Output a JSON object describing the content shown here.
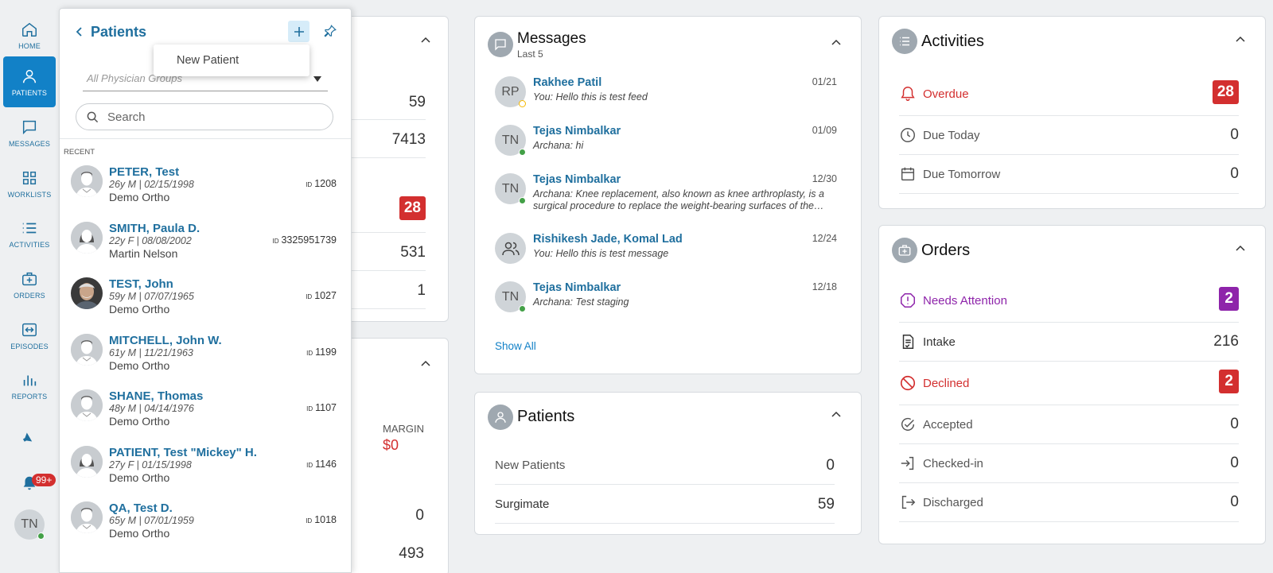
{
  "nav": {
    "items": [
      {
        "label": "HOME",
        "icon": "home-icon"
      },
      {
        "label": "PATIENTS",
        "icon": "person-icon"
      },
      {
        "label": "MESSAGES",
        "icon": "chat-icon"
      },
      {
        "label": "WORKLISTS",
        "icon": "grid-icon"
      },
      {
        "label": "ACTIVITIES",
        "icon": "list-icon"
      },
      {
        "label": "ORDERS",
        "icon": "medical-bag-icon"
      },
      {
        "label": "EPISODES",
        "icon": "episodes-icon"
      },
      {
        "label": "REPORTS",
        "icon": "bar-chart-icon"
      }
    ],
    "notification_badge": "99+",
    "user_initials": "TN"
  },
  "patients_panel": {
    "title": "Patients",
    "new_patient_menu": "New Patient",
    "group_placeholder": "All Physician Groups",
    "search_placeholder": "Search",
    "recent_label": "RECENT",
    "id_prefix": "ID",
    "patients": [
      {
        "name": "PETER, Test",
        "info": "26y M | 02/15/1998",
        "physician": "Demo Ortho",
        "id": "1208",
        "avatar": "male"
      },
      {
        "name": "SMITH, Paula D.",
        "info": "22y F | 08/08/2002",
        "physician": "Martin Nelson",
        "id": "3325951739",
        "avatar": "female"
      },
      {
        "name": "TEST, John",
        "info": "59y M | 07/07/1965",
        "physician": "Demo Ortho",
        "id": "1027",
        "avatar": "photo"
      },
      {
        "name": "MITCHELL, John W.",
        "info": "61y M | 11/21/1963",
        "physician": "Demo Ortho",
        "id": "1199",
        "avatar": "male"
      },
      {
        "name": "SHANE, Thomas",
        "info": "48y M | 04/14/1976",
        "physician": "Demo Ortho",
        "id": "1107",
        "avatar": "male"
      },
      {
        "name": "PATIENT, Test \"Mickey\" H.",
        "info": "27y F | 01/15/1998",
        "physician": "Demo Ortho",
        "id": "1146",
        "avatar": "female"
      },
      {
        "name": "QA, Test D.",
        "info": "65y M | 07/01/1959",
        "physician": "Demo Ortho",
        "id": "1018",
        "avatar": "male"
      }
    ]
  },
  "hidden_card": {
    "values": [
      "59",
      "7413",
      "28",
      "531",
      "1"
    ],
    "margin_label": "MARGIN",
    "margin_value": "$0",
    "values2": [
      "0",
      "493"
    ]
  },
  "messages": {
    "title": "Messages",
    "subtitle": "Last 5",
    "show_all": "Show All",
    "items": [
      {
        "initials": "RP",
        "name": "Rakhee Patil",
        "date": "01/21",
        "text": "You: Hello this is test feed",
        "status": "away"
      },
      {
        "initials": "TN",
        "name": "Tejas Nimbalkar",
        "date": "01/09",
        "text": "Archana: hi",
        "status": "online"
      },
      {
        "initials": "TN",
        "name": "Tejas Nimbalkar",
        "date": "12/30",
        "text": "Archana: Knee replacement, also known as knee arthroplasty, is a surgical procedure to replace the weight-bearing surfaces of the…",
        "status": "online"
      },
      {
        "initials": "",
        "name": "Rishikesh Jade, Komal Lad",
        "date": "12/24",
        "text": "You: Hello this is test message",
        "status": "group"
      },
      {
        "initials": "TN",
        "name": "Tejas Nimbalkar",
        "date": "12/18",
        "text": "Archana: Test staging",
        "status": "online"
      }
    ]
  },
  "patients_card": {
    "title": "Patients",
    "rows": [
      {
        "label": "New Patients",
        "value": "0"
      },
      {
        "label": "Surgimate",
        "value": "59"
      }
    ]
  },
  "activities": {
    "title": "Activities",
    "rows": [
      {
        "label": "Overdue",
        "value": "28",
        "style": "alert"
      },
      {
        "label": "Due Today",
        "value": "0"
      },
      {
        "label": "Due Tomorrow",
        "value": "0"
      }
    ]
  },
  "orders": {
    "title": "Orders",
    "rows": [
      {
        "label": "Needs Attention",
        "value": "2",
        "style": "purple"
      },
      {
        "label": "Intake",
        "value": "216"
      },
      {
        "label": "Declined",
        "value": "2",
        "style": "alert"
      },
      {
        "label": "Accepted",
        "value": "0"
      },
      {
        "label": "Checked-in",
        "value": "0"
      },
      {
        "label": "Discharged",
        "value": "0"
      }
    ]
  },
  "colors": {
    "accent": "#1281c7",
    "link": "#1f6f9e",
    "alert": "#d32f2f",
    "purple": "#8e24aa"
  }
}
